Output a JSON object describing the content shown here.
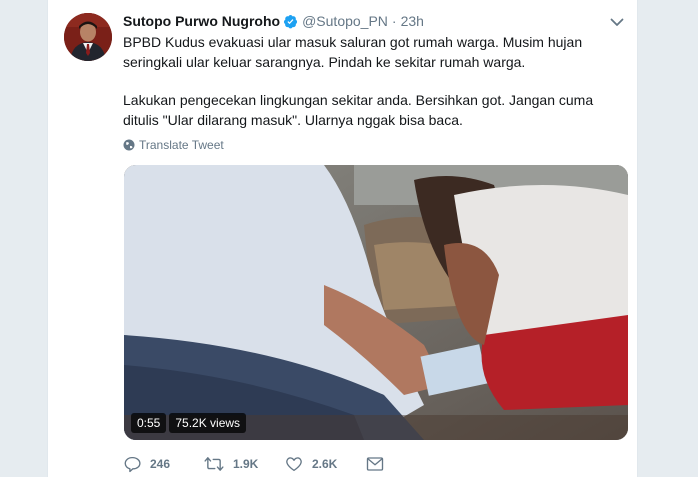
{
  "tweet": {
    "author_name": "Sutopo Purwo Nugroho",
    "handle": "@Sutopo_PN",
    "separator": "·",
    "time": "23h",
    "paragraph_1": "BPBD Kudus evakuasi ular masuk saluran got rumah warga. Musim hujan seringkali ular keluar sarangnya. Pindah ke sekitar rumah warga.",
    "paragraph_2": "Lakukan pengecekan lingkungan sekitar anda. Bersihkan got. Jangan cuma ditulis \"Ular dilarang masuk\". Ularnya nggak bisa baca.",
    "translate_label": "Translate Tweet"
  },
  "video": {
    "duration": "0:55",
    "views": "75.2K views"
  },
  "actions": {
    "replies": "246",
    "retweets": "1.9K",
    "likes": "2.6K"
  },
  "colors": {
    "background": "#e6ecf0",
    "verified": "#1da1f2",
    "muted": "#657786"
  },
  "icons": [
    "verified-badge-icon",
    "chevron-down-icon",
    "globe-icon",
    "reply-icon",
    "retweet-icon",
    "like-icon",
    "message-icon"
  ]
}
